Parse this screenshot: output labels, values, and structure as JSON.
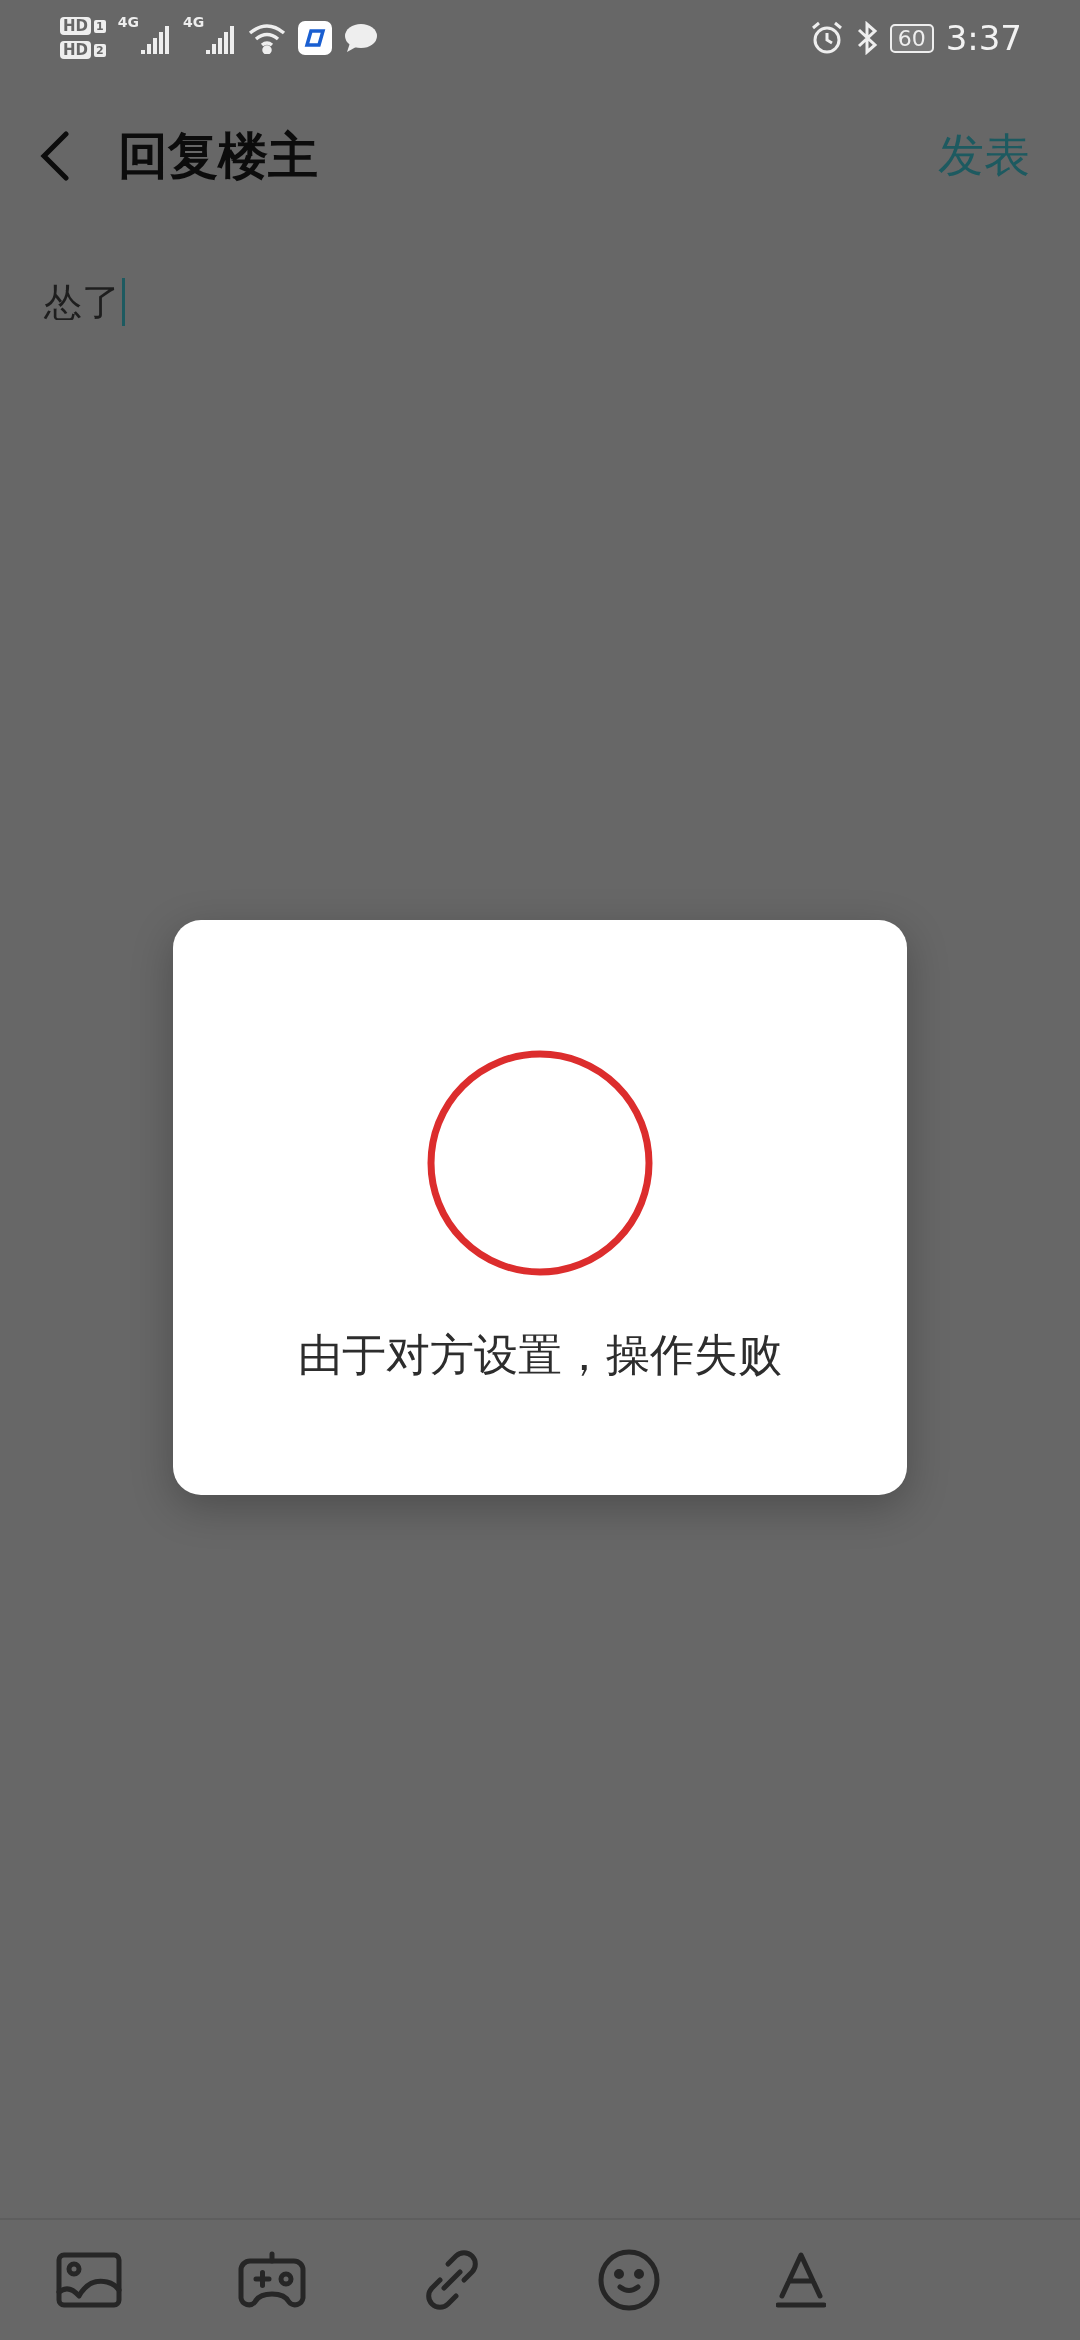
{
  "status_bar": {
    "sims": [
      {
        "badge": "HD",
        "slot": "1"
      },
      {
        "badge": "HD",
        "slot": "2"
      }
    ],
    "networks": [
      "4G",
      "4G"
    ],
    "battery": "60",
    "time": "3:37"
  },
  "header": {
    "title": "回复楼主",
    "action": "发表"
  },
  "editor": {
    "value": "怂了"
  },
  "dialog": {
    "message": "由于对方设置，操作失败"
  },
  "toolbar": {
    "items": [
      {
        "kind": "image"
      },
      {
        "kind": "game"
      },
      {
        "kind": "link"
      },
      {
        "kind": "emoji"
      },
      {
        "kind": "format"
      }
    ]
  }
}
